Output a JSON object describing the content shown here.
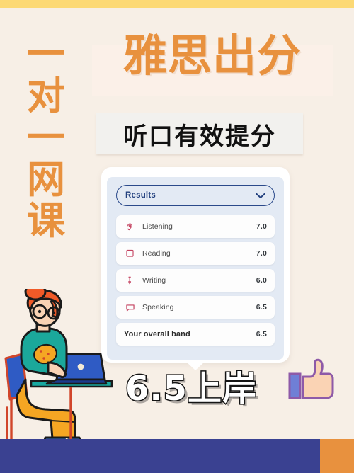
{
  "poster": {
    "background_color": "#F7EFE6",
    "top_banner_color": "#FCD975",
    "floor_band_color": "#3A4191",
    "floor_accent_color": "#E8913E",
    "accent_orange": "#E8913E",
    "navy": "#22407E",
    "crimson": "#C4415F"
  },
  "side_text": {
    "chars": [
      "一",
      "对",
      "一",
      "网",
      "课"
    ],
    "full": "一对一网课"
  },
  "heading": {
    "main": "雅思出分",
    "sub": "听口有效提分"
  },
  "card": {
    "dropdown": {
      "label": "Results",
      "chevron_icon": "chevron-down-icon"
    },
    "rows": [
      {
        "icon": "ear-icon",
        "label": "Listening",
        "score": "7.0"
      },
      {
        "icon": "book-icon",
        "label": "Reading",
        "score": "7.0"
      },
      {
        "icon": "pen-icon",
        "label": "Writing",
        "score": "6.0"
      },
      {
        "icon": "speech-bubble-icon",
        "label": "Speaking",
        "score": "6.5"
      }
    ],
    "total": {
      "label": "Your overall band",
      "score": "6.5"
    }
  },
  "footer": {
    "headline": "6.5上岸",
    "thumb_icon": "thumbs-up-icon"
  },
  "illustration": {
    "name": "student-at-desk-illustration",
    "hair_color": "#F05A28",
    "shirt_color": "#1BA89B",
    "pants_color": "#F5A623",
    "laptop_color": "#2F5BC4",
    "shoe_color": "#2F6FC4"
  }
}
